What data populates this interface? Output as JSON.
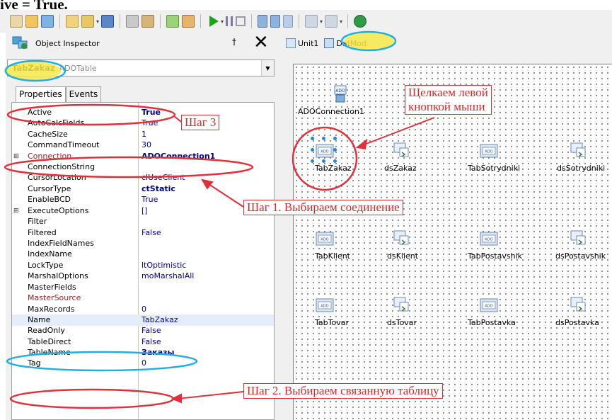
{
  "caption": "ive = True.",
  "toolbar": {
    "icons": [
      "new-icon",
      "open-icon",
      "save-icon",
      "open-project-icon",
      "dropdown-icon",
      "save-all-icon",
      "print-icon",
      "clipboard-icon",
      "add-icon",
      "remove-icon",
      "run-icon",
      "dropdown-icon",
      "pause-icon",
      "stop-icon",
      "step-over-icon",
      "trace-into-icon",
      "step-icon",
      "back-icon",
      "dropdown-icon",
      "forward-icon",
      "dropdown-icon",
      "help-icon"
    ]
  },
  "object_inspector": {
    "title": "Object Inspector",
    "pin": "†",
    "close": "✕",
    "selected_object": "TabZakaz",
    "selected_class": "ADOTable",
    "tabs": [
      "Properties",
      "Events"
    ],
    "properties": [
      {
        "name": "Active",
        "value": "True",
        "bold": true
      },
      {
        "name": "AutoCalcFields",
        "value": "True"
      },
      {
        "name": "CacheSize",
        "value": "1"
      },
      {
        "name": "CommandTimeout",
        "value": "30"
      },
      {
        "name": "Connection",
        "value": "ADOConnection1",
        "bold": true,
        "expand": "⊞",
        "red": true
      },
      {
        "name": "ConnectionString",
        "value": ""
      },
      {
        "name": "CursorLocation",
        "value": "clUseClient"
      },
      {
        "name": "CursorType",
        "value": "ctStatic",
        "bold": true
      },
      {
        "name": "EnableBCD",
        "value": "True"
      },
      {
        "name": "ExecuteOptions",
        "value": "[]",
        "expand": "⊞"
      },
      {
        "name": "Filter",
        "value": ""
      },
      {
        "name": "Filtered",
        "value": "False"
      },
      {
        "name": "IndexFieldNames",
        "value": ""
      },
      {
        "name": "IndexName",
        "value": ""
      },
      {
        "name": "LockType",
        "value": "ltOptimistic"
      },
      {
        "name": "MarshalOptions",
        "value": "moMarshalAll"
      },
      {
        "name": "MasterFields",
        "value": ""
      },
      {
        "name": "MasterSource",
        "value": "",
        "red": true
      },
      {
        "name": "MaxRecords",
        "value": "0"
      },
      {
        "name": "Name",
        "value": "TabZakaz"
      },
      {
        "name": "ReadOnly",
        "value": "False"
      },
      {
        "name": "TableDirect",
        "value": "False"
      },
      {
        "name": "TableName",
        "value": "Заказы",
        "bold": true
      },
      {
        "name": "Tag",
        "value": "0"
      }
    ]
  },
  "designer": {
    "tabs": [
      "Unit1",
      "DatMod"
    ],
    "components": [
      {
        "name": "ADOConnection1",
        "kind": "connection"
      },
      {
        "name": "TabZakaz",
        "kind": "table",
        "selected": true
      },
      {
        "name": "dsZakaz",
        "kind": "datasource"
      },
      {
        "name": "TabSotrydniki",
        "kind": "table"
      },
      {
        "name": "dsSotrydniki",
        "kind": "datasource"
      },
      {
        "name": "TabKlient",
        "kind": "table"
      },
      {
        "name": "dsKlient",
        "kind": "datasource"
      },
      {
        "name": "TabPostavshik",
        "kind": "table"
      },
      {
        "name": "dsPostavshik",
        "kind": "datasource"
      },
      {
        "name": "TabTovar",
        "kind": "table"
      },
      {
        "name": "dsTovar",
        "kind": "datasource"
      },
      {
        "name": "TabPostavka",
        "kind": "table"
      },
      {
        "name": "dsPostavka",
        "kind": "datasource"
      }
    ]
  },
  "annotations": {
    "click_left_line1": "Щелкаем левой",
    "click_left_line2": "кнопкой мыши",
    "step3": "Шаг 3",
    "step1": "Шаг 1. Выбираем соединение",
    "step2": "Шаг 2. Выбираем связанную таблицу"
  },
  "colors": {
    "annotation_red": "#e0303a",
    "highlight_blue": "#1eaee6",
    "highlight_yellow": "#f7e94a"
  }
}
